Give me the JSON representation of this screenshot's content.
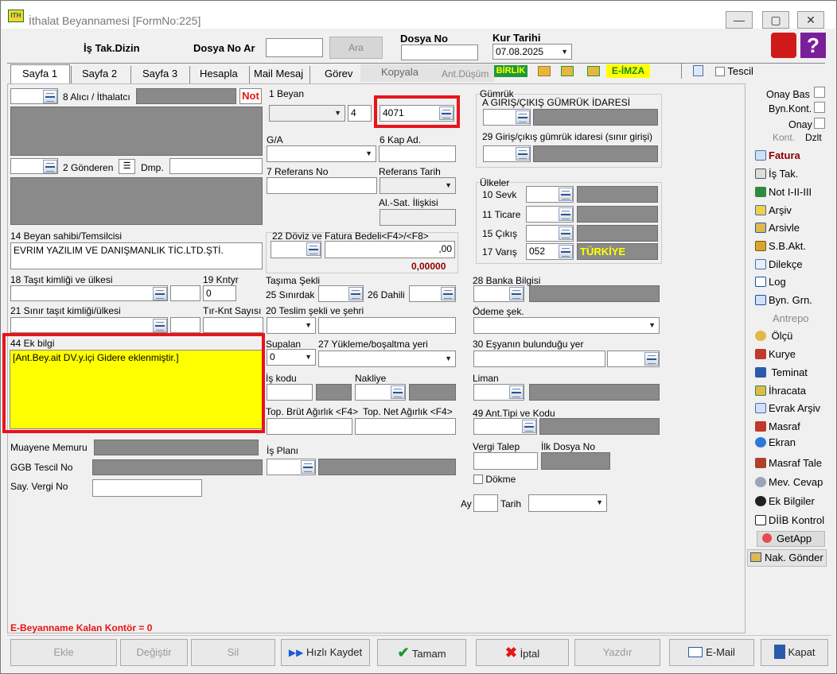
{
  "window": {
    "title": "İthalat Beyannamesi [FormNo:225]",
    "controls": [
      "—",
      "▢",
      "✕"
    ]
  },
  "header": {
    "is_tak_dizin": "İş Tak.Dizin",
    "dosya_no_ar": "Dosya No Ar",
    "ara": "Ara",
    "dosya_no": "Dosya No",
    "kur_tarihi": "Kur Tarihi",
    "kur_tarihi_value": "07.08.2025"
  },
  "tabs": [
    "Sayfa 1",
    "Sayfa 2",
    "Sayfa 3",
    "Hesapla",
    "Mail Mesaj",
    "Görev",
    "Kopyala",
    "Ant.Düşüm"
  ],
  "toolbar": {
    "birlik": "BİRLİK",
    "eimza": "E-İMZA",
    "tescil": "Tescil"
  },
  "left": {
    "alici": "8 Alıcı / İthalatcı",
    "not": "Not",
    "gonderen": "2 Gönderen",
    "dmp": "Dmp.",
    "beyan_sahibi": "14 Beyan sahibi/Temsilcisi",
    "beyan_sahibi_value": "EVRIM YAZILIM VE DANIŞMANLIK TİC.LTD.ŞTİ.",
    "tasit": "18 Taşıt kimliği ve ülkesi",
    "kntyr": "19 Kntyr",
    "kntyr_value": "0",
    "sinir_tasit": "21 Sınır taşıt kimliği/ülkesi",
    "tir_knt": "Tır-Knt Sayısı",
    "ek_bilgi": "44 Ek bilgi",
    "ek_bilgi_value": "[Ant.Bey.ait DV.y.içi Gidere eklenmiştir.]",
    "muayene": "Muayene Memuru",
    "ggb": "GGB Tescil No",
    "say_vergi": "Say. Vergi No",
    "kontor": "E-Beyanname Kalan Kontör = 0"
  },
  "middle": {
    "beyan": "1 Beyan",
    "beyan_num": "4",
    "beyan_code": "4071",
    "ga": "G/A",
    "kap_ad": "6 Kap Ad.",
    "referans_no": "7 Referans No",
    "referans_tarih": "Referans Tarih",
    "al_sat": "Al.-Sat. İlişkisi",
    "doviz": "22 Döviz ve Fatura Bedeli<F4>/<F8>",
    "doviz_value": ",00",
    "doviz_total": "0,00000",
    "tasima": "Taşıma Şekli",
    "sinirdaki": "25 Sınırdak",
    "dahili": "26 Dahili",
    "teslim": "20 Teslim şekli ve şehri",
    "supalan": "Supalan",
    "supalan_value": "0",
    "yukleme": "27 Yükleme/boşaltma yeri",
    "is_kodu": "İş kodu",
    "nakliye": "Nakliye",
    "top_brut": "Top. Brüt Ağırlık <F4>",
    "top_net": "Top. Net Ağırlık <F4>",
    "is_plani": "İş Planı"
  },
  "right": {
    "gumruk": "Gümrük",
    "giris_cikis": "A GIRIŞ/ÇIKIŞ GÜMRÜK İDARESİ",
    "giris_idaresi": "29 Giriş/çıkış gümrük idaresi (sınır girişi)",
    "ulkeler": "Ülkeler",
    "sevk": "10 Sevk",
    "ticaret": "11 Ticare",
    "cikis": "15 Çıkış",
    "varis": "17 Varış",
    "varis_code": "052",
    "varis_name": "TÜRKİYE",
    "banka": "28 Banka Bilgisi",
    "odeme": "Ödeme şek.",
    "esya": "30 Eşyanın bulunduğu yer",
    "liman": "Liman",
    "ant_tipi": "49 Ant.Tipi ve Kodu",
    "vergi_talep": "Vergi Talep",
    "ilk_dosya": "İlk Dosya No",
    "dokme": "Dökme",
    "ay": "Ay",
    "tarih": "Tarih"
  },
  "sidebar": {
    "onay_bas": "Onay Bas",
    "byn_kont": "Byn.Kont.",
    "onay": "Onay",
    "kont": "Kont.",
    "dzlt": "Dzlt",
    "items": [
      "Fatura",
      "İş Tak.",
      "Not I-II-III",
      "Arşiv",
      "Arsivle",
      "S.B.Akt.",
      "Dilekçe",
      "Log",
      "Byn. Grn.",
      "Antrepo",
      "Ölçü",
      "Kurye",
      "Teminat",
      "İhracata",
      "Evrak Arşiv",
      "Masraf",
      "Ekran",
      "Masraf Tale",
      "Mev. Cevap",
      "Ek Bilgiler",
      "DİİB Kontrol",
      "GetApp",
      "Nak. Gönder"
    ]
  },
  "buttons": [
    "Ekle",
    "Değiştir",
    "Sil",
    "Hızlı Kaydet",
    "Tamam",
    "İptal",
    "Yazdır",
    "E-Mail",
    "Kapat"
  ]
}
